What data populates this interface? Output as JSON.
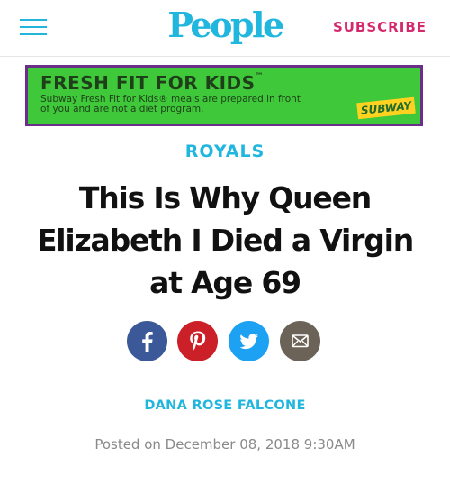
{
  "header": {
    "logo": "People",
    "subscribe_label": "SUBSCRIBE"
  },
  "ad": {
    "title": "FRESH FIT FOR KIDS",
    "trademark": "™",
    "text": "Subway Fresh Fit for Kids® meals are prepared in front of you and are not a diet program.",
    "brand": "SUBWAY"
  },
  "article": {
    "section": "ROYALS",
    "headline": "This Is Why Queen Elizabeth I Died a Virgin at Age 69",
    "author": "DANA ROSE FALCONE",
    "posted": "Posted on December 08, 2018 9:30AM"
  },
  "share": [
    {
      "icon": "facebook-icon",
      "color": "#3b5998"
    },
    {
      "icon": "pinterest-icon",
      "color": "#cb2027"
    },
    {
      "icon": "twitter-icon",
      "color": "#1da1f2"
    },
    {
      "icon": "email-icon",
      "color": "#6b6358"
    }
  ],
  "colors": {
    "brand": "#20b6de",
    "subscribe": "#d5296e",
    "ad_background": "#3fc83a",
    "ad_border": "#6b2f8a"
  }
}
